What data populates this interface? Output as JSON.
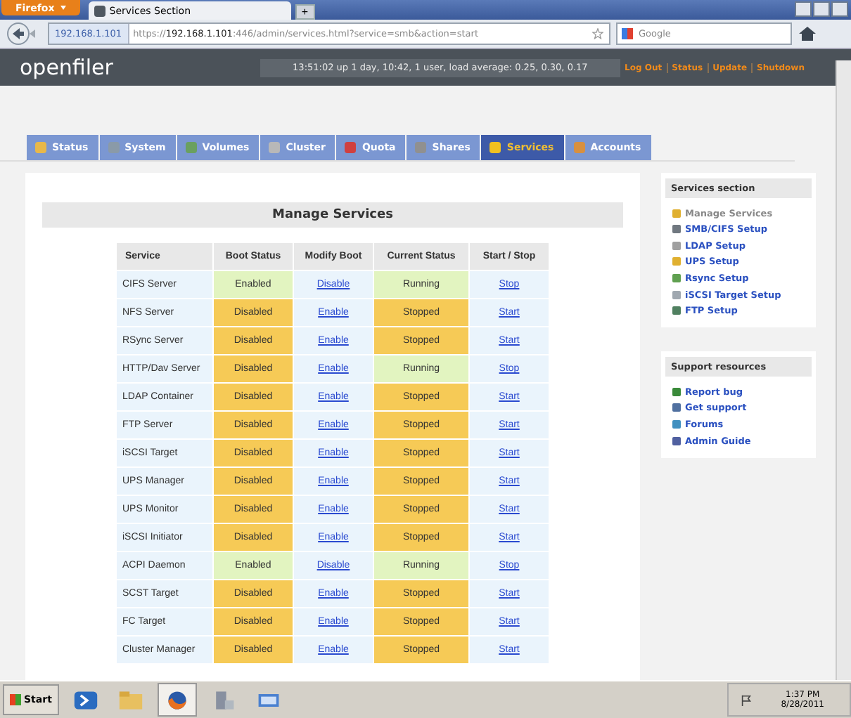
{
  "browser": {
    "menu_button": "Firefox",
    "tab_title": "Services Section",
    "new_tab": "+",
    "site_identity": "192.168.1.101",
    "url_host": "192.168.1.101",
    "url_scheme": "https://",
    "url_rest": ":446/admin/services.html?service=smb&action=start",
    "search_placeholder": "Google"
  },
  "header": {
    "logo": "openfiler",
    "uptime": "13:51:02 up 1 day, 10:42, 1 user, load average: 0.25, 0.30, 0.17",
    "links": [
      "Log Out",
      "Status",
      "Update",
      "Shutdown"
    ]
  },
  "tabs": [
    {
      "label": "Status",
      "selected": false,
      "color": "#e8b84a"
    },
    {
      "label": "System",
      "selected": false,
      "color": "#8a9aa8"
    },
    {
      "label": "Volumes",
      "selected": false,
      "color": "#6aa060"
    },
    {
      "label": "Cluster",
      "selected": false,
      "color": "#b8b8b8"
    },
    {
      "label": "Quota",
      "selected": false,
      "color": "#d04040"
    },
    {
      "label": "Shares",
      "selected": false,
      "color": "#909090"
    },
    {
      "label": "Services",
      "selected": true,
      "color": "#f0c020"
    },
    {
      "label": "Accounts",
      "selected": false,
      "color": "#d89040"
    }
  ],
  "main": {
    "title": "Manage Services",
    "columns": [
      "Service",
      "Boot Status",
      "Modify Boot",
      "Current Status",
      "Start / Stop"
    ],
    "rows": [
      {
        "service": "CIFS Server",
        "boot_enabled": true,
        "boot": "Enabled",
        "modify": "Disable",
        "running": true,
        "status": "Running",
        "action": "Stop"
      },
      {
        "service": "NFS Server",
        "boot_enabled": false,
        "boot": "Disabled",
        "modify": "Enable",
        "running": false,
        "status": "Stopped",
        "action": "Start"
      },
      {
        "service": "RSync Server",
        "boot_enabled": false,
        "boot": "Disabled",
        "modify": "Enable",
        "running": false,
        "status": "Stopped",
        "action": "Start"
      },
      {
        "service": "HTTP/Dav Server",
        "boot_enabled": false,
        "boot": "Disabled",
        "modify": "Enable",
        "running": true,
        "status": "Running",
        "action": "Stop"
      },
      {
        "service": "LDAP Container",
        "boot_enabled": false,
        "boot": "Disabled",
        "modify": "Enable",
        "running": false,
        "status": "Stopped",
        "action": "Start"
      },
      {
        "service": "FTP Server",
        "boot_enabled": false,
        "boot": "Disabled",
        "modify": "Enable",
        "running": false,
        "status": "Stopped",
        "action": "Start"
      },
      {
        "service": "iSCSI Target",
        "boot_enabled": false,
        "boot": "Disabled",
        "modify": "Enable",
        "running": false,
        "status": "Stopped",
        "action": "Start"
      },
      {
        "service": "UPS Manager",
        "boot_enabled": false,
        "boot": "Disabled",
        "modify": "Enable",
        "running": false,
        "status": "Stopped",
        "action": "Start"
      },
      {
        "service": "UPS Monitor",
        "boot_enabled": false,
        "boot": "Disabled",
        "modify": "Enable",
        "running": false,
        "status": "Stopped",
        "action": "Start"
      },
      {
        "service": "iSCSI Initiator",
        "boot_enabled": false,
        "boot": "Disabled",
        "modify": "Enable",
        "running": false,
        "status": "Stopped",
        "action": "Start"
      },
      {
        "service": "ACPI Daemon",
        "boot_enabled": true,
        "boot": "Enabled",
        "modify": "Disable",
        "running": true,
        "status": "Running",
        "action": "Stop"
      },
      {
        "service": "SCST Target",
        "boot_enabled": false,
        "boot": "Disabled",
        "modify": "Enable",
        "running": false,
        "status": "Stopped",
        "action": "Start"
      },
      {
        "service": "FC Target",
        "boot_enabled": false,
        "boot": "Disabled",
        "modify": "Enable",
        "running": false,
        "status": "Stopped",
        "action": "Start"
      },
      {
        "service": "Cluster Manager",
        "boot_enabled": false,
        "boot": "Disabled",
        "modify": "Enable",
        "running": false,
        "status": "Stopped",
        "action": "Start"
      }
    ]
  },
  "sidebar": [
    {
      "title": "Services section",
      "items": [
        {
          "label": "Manage Services",
          "selected": true,
          "color": "#e0b030"
        },
        {
          "label": "SMB/CIFS Setup",
          "selected": false,
          "color": "#707880"
        },
        {
          "label": "LDAP Setup",
          "selected": false,
          "color": "#a0a0a0"
        },
        {
          "label": "UPS Setup",
          "selected": false,
          "color": "#e0b030"
        },
        {
          "label": "Rsync Setup",
          "selected": false,
          "color": "#60a050"
        },
        {
          "label": "iSCSI Target Setup",
          "selected": false,
          "color": "#a0a8b0"
        },
        {
          "label": "FTP Setup",
          "selected": false,
          "color": "#508060"
        }
      ]
    },
    {
      "title": "Support resources",
      "items": [
        {
          "label": "Report bug",
          "selected": false,
          "color": "#3a8a3a"
        },
        {
          "label": "Get support",
          "selected": false,
          "color": "#5070a0"
        },
        {
          "label": "Forums",
          "selected": false,
          "color": "#4090c0"
        },
        {
          "label": "Admin Guide",
          "selected": false,
          "color": "#5060a0"
        }
      ]
    }
  ],
  "taskbar": {
    "start": "Start",
    "time": "1:37 PM",
    "date": "8/28/2011"
  }
}
